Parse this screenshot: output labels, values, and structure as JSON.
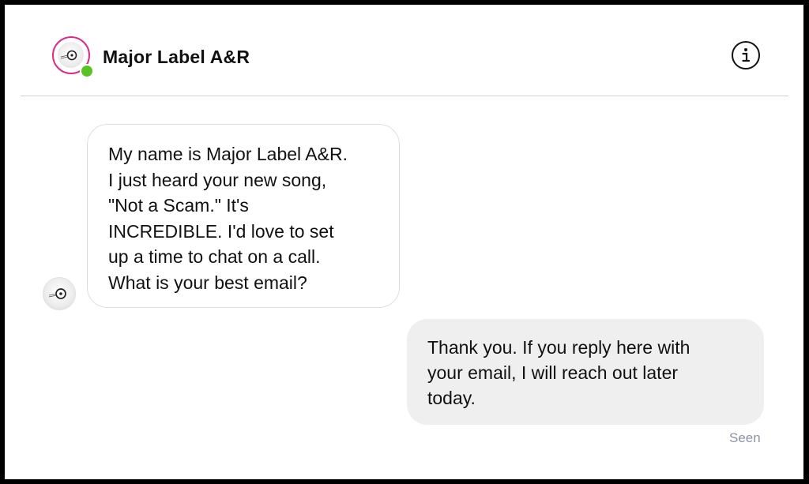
{
  "header": {
    "title": "Major Label A&R",
    "status": "online",
    "avatar_icon": "vinyl-logo-icon",
    "info_icon": "info-icon"
  },
  "messages": [
    {
      "direction": "incoming",
      "text": "My name is Major Label A&R.\nI just heard your new song,\n\"Not a Scam.\" It's\nINCREDIBLE. I'd love to set\nup a time to chat on a call.\nWhat is your best email?"
    },
    {
      "direction": "outgoing",
      "text": "Thank you. If you reply here with\nyour email, I will reach out later\ntoday."
    }
  ],
  "receipt": "Seen",
  "colors": {
    "story_ring": "#d62f8a",
    "online": "#58c322",
    "outgoing_bubble": "#efefef",
    "seen_text": "#8a94a6"
  }
}
